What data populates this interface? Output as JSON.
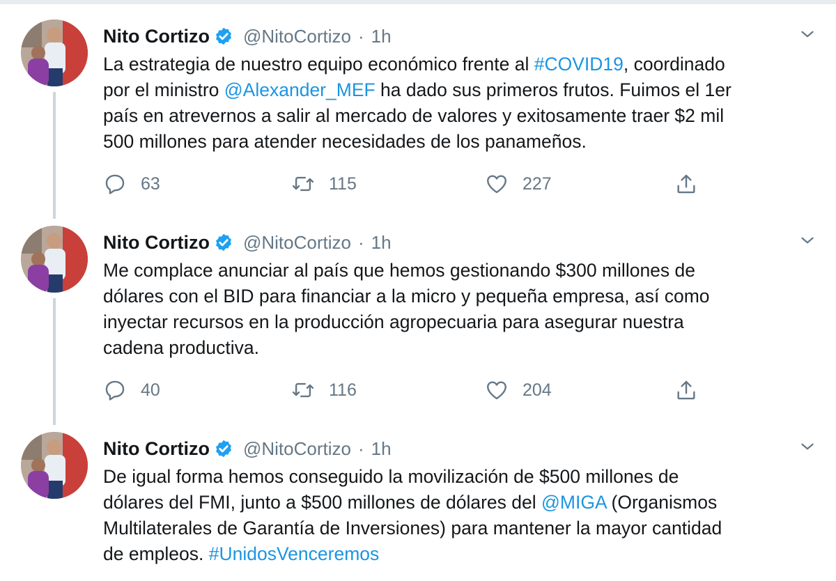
{
  "tweets": [
    {
      "author": "Nito Cortizo",
      "handle": "@NitoCortizo",
      "separator": "·",
      "time": "1h",
      "text_parts": {
        "p1": "La estrategia de nuestro equipo económico frente al ",
        "l1": "#COVID19",
        "p2": ", coordinado\npor el ministro ",
        "l2": "@Alexander_MEF",
        "p3": " ha dado sus primeros frutos. Fuimos el 1er\npaís en atrevernos a salir al mercado de valores y exitosamente traer $2 mil\n500 millones para atender necesidades de los panameños."
      },
      "replies": "63",
      "retweets": "115",
      "likes": "227"
    },
    {
      "author": "Nito Cortizo",
      "handle": "@NitoCortizo",
      "separator": "·",
      "time": "1h",
      "text_parts": {
        "p1": "Me complace anunciar al país que hemos gestionando $300 millones de\ndólares con el BID para financiar a la micro y pequeña empresa, así como\ninyectar recursos en la producción agropecuaria para asegurar nuestra\ncadena productiva."
      },
      "replies": "40",
      "retweets": "116",
      "likes": "204"
    },
    {
      "author": "Nito Cortizo",
      "handle": "@NitoCortizo",
      "separator": "·",
      "time": "1h",
      "text_parts": {
        "p1": "De igual forma hemos conseguido la movilización de $500 millones de\ndólares del FMI, junto a $500 millones de dólares del ",
        "l1": "@MIGA",
        "p2": " (Organismos\nMultilaterales de Garantía de Inversiones) para mantener la mayor cantidad\nde empleos. ",
        "l2": "#UnidosVenceremos"
      }
    }
  ],
  "icons": {
    "reply": "reply-icon",
    "retweet": "retweet-icon",
    "like": "heart-icon",
    "share": "share-icon",
    "verified": "verified-badge-icon",
    "caret": "chevron-down-icon"
  },
  "colors": {
    "link": "#1b95e0",
    "verified": "#1da1f2",
    "muted": "#657786",
    "thread_line": "#ccd6dd"
  }
}
